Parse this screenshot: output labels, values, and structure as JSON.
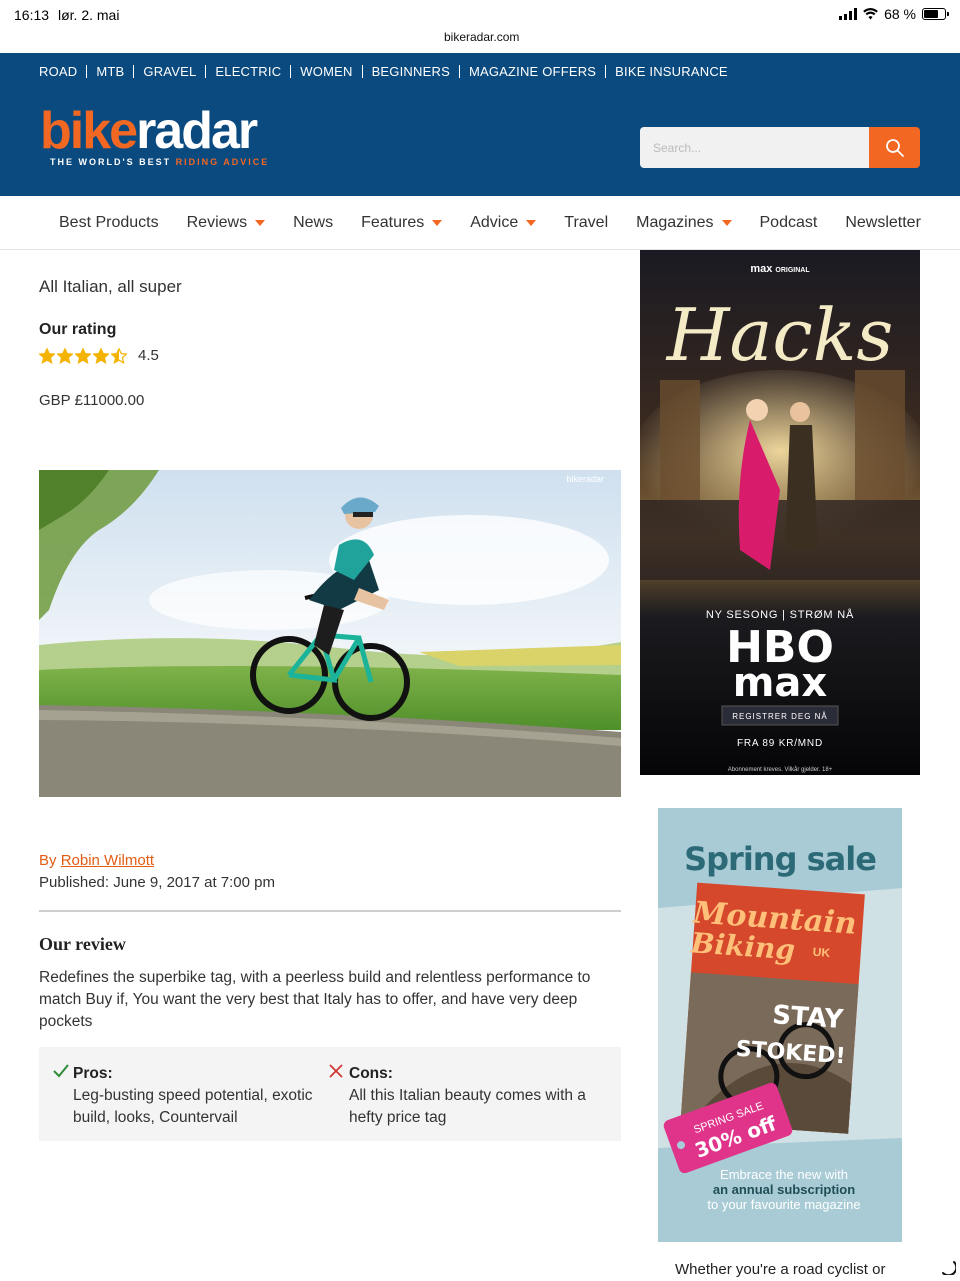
{
  "status": {
    "time": "16:13",
    "date": "lør. 2. mai",
    "battery": "68 %",
    "battery_level": 0.68,
    "url": "bikeradar.com"
  },
  "topnav": [
    "ROAD",
    "MTB",
    "GRAVEL",
    "ELECTRIC",
    "WOMEN",
    "BEGINNERS",
    "MAGAZINE OFFERS",
    "BIKE INSURANCE"
  ],
  "logo": {
    "bike": "bike",
    "radar": "radar",
    "tagline_white": "THE WORLD'S BEST ",
    "tagline_orange": "RIDING ADVICE"
  },
  "search": {
    "placeholder": "Search..."
  },
  "mainnav": [
    {
      "label": "Best Products",
      "dropdown": false
    },
    {
      "label": "Reviews",
      "dropdown": true
    },
    {
      "label": "News",
      "dropdown": false
    },
    {
      "label": "Features",
      "dropdown": true
    },
    {
      "label": "Advice",
      "dropdown": true
    },
    {
      "label": "Travel",
      "dropdown": false
    },
    {
      "label": "Magazines",
      "dropdown": true
    },
    {
      "label": "Podcast",
      "dropdown": false
    },
    {
      "label": "Newsletter",
      "dropdown": false
    }
  ],
  "article": {
    "subtitle": "All Italian, all super",
    "rating_label": "Our rating",
    "rating": 4.5,
    "rating_text": "4.5",
    "price": "GBP £11000.00",
    "image_watermark": "bikeradar",
    "byline_prefix": "By ",
    "author": "Robin Wilmott",
    "published": "Published: June 9, 2017 at 7:00 pm",
    "review_heading": "Our review",
    "review_text": "Redefines the superbike tag, with a peerless build and relentless performance to match Buy if, You want the very best that Italy has to offer, and have very deep pockets",
    "pros_label": "Pros:",
    "pros_text": "Leg-busting speed potential, exotic build, looks, Countervail",
    "cons_label": "Cons:",
    "cons_text": "All this Italian beauty comes with a hefty price tag"
  },
  "ad_hbo": {
    "brand": "max",
    "brand_suffix": "ORIGINAL",
    "title": "Hacks",
    "tagline": "NY SESONG | STRØM NÅ",
    "logo_line1": "HBO",
    "logo_line2": "max",
    "cta": "REGISTRER DEG NÅ",
    "price": "FRA 89 KR/MND",
    "fineprint": "Abonnement kreves. Vilkår gjelder. 18+"
  },
  "ad_mbuk": {
    "headline": "Spring sale",
    "mag_title_1": "Mountain",
    "mag_title_2": "Biking",
    "mag_uk": "UK",
    "cover_line_1": "STAY",
    "cover_line_2": "STOKED!",
    "tag_line_1": "SPRING SALE",
    "tag_line_2": "30% off",
    "footer_1": "Embrace the new with",
    "footer_2": "an annual subscription",
    "footer_3": "to your favourite magazine"
  },
  "teaser": "Whether you're a road cyclist or",
  "colors": {
    "brand_blue": "#0b4a7f",
    "brand_orange": "#f26722",
    "star": "#f5b301",
    "pro_check": "#2e8b3a",
    "con_x": "#d0312d"
  }
}
